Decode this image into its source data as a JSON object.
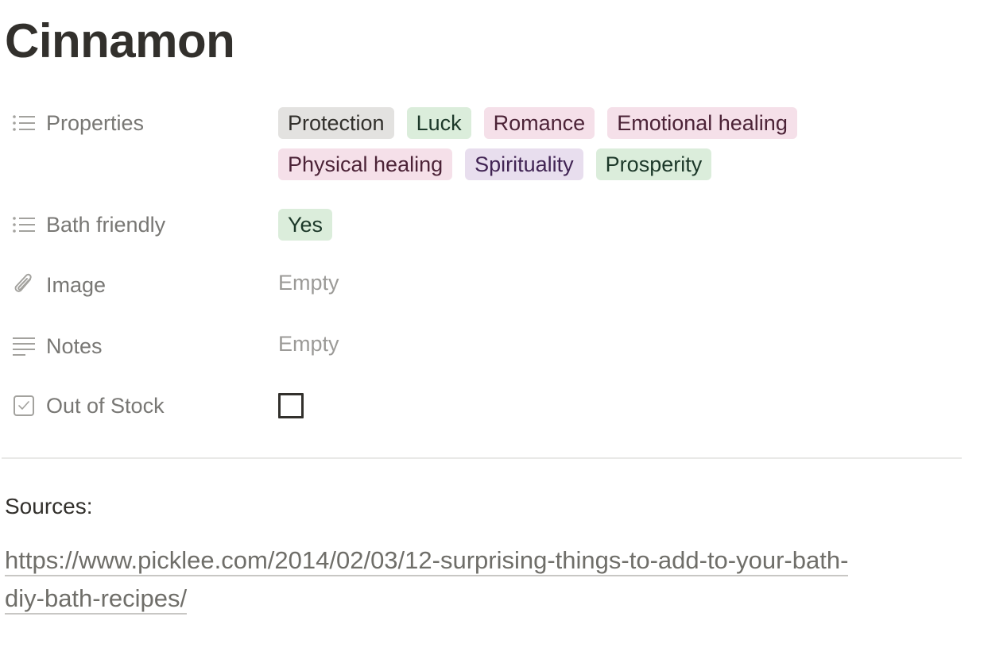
{
  "page": {
    "title": "Cinnamon"
  },
  "properties": [
    {
      "name": "Properties",
      "icon": "multi-select-list-icon",
      "type": "multi_select",
      "tags": [
        {
          "label": "Protection",
          "color": "gray"
        },
        {
          "label": "Luck",
          "color": "green"
        },
        {
          "label": "Romance",
          "color": "pink"
        },
        {
          "label": "Emotional healing",
          "color": "pink"
        },
        {
          "label": "Physical healing",
          "color": "pink"
        },
        {
          "label": "Spirituality",
          "color": "purple"
        },
        {
          "label": "Prosperity",
          "color": "green"
        }
      ]
    },
    {
      "name": "Bath friendly",
      "icon": "multi-select-list-icon",
      "type": "select",
      "tags": [
        {
          "label": "Yes",
          "color": "green"
        }
      ]
    },
    {
      "name": "Image",
      "icon": "paperclip-icon",
      "type": "files",
      "value": "Empty"
    },
    {
      "name": "Notes",
      "icon": "text-lines-icon",
      "type": "text",
      "value": "Empty"
    },
    {
      "name": "Out of Stock",
      "icon": "checkbox-icon",
      "type": "checkbox",
      "checked": false
    }
  ],
  "content": {
    "sources_label": "Sources:",
    "source_url": "https://www.picklee.com/2014/02/03/12-surprising-things-to-add-to-your-bath-diy-bath-recipes/"
  },
  "colors": {
    "tag_gray_bg": "#e3e2e0",
    "tag_green_bg": "#dbeddb",
    "tag_pink_bg": "#f5e0e9",
    "tag_purple_bg": "#e8deee",
    "label_text": "#787774",
    "empty_text": "#9b9a97"
  }
}
